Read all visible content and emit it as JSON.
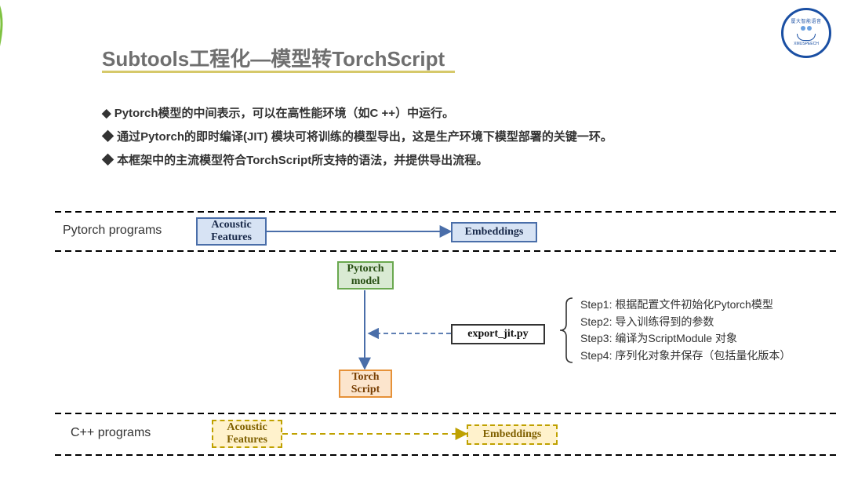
{
  "title": "Subtools工程化—模型转TorchScript",
  "bullets": {
    "b1": "Pytorch模型的中间表示，可以在高性能环境（如C ++）中运行。",
    "b2": "通过Pytorch的即时编译(JIT) 模块可将训练的模型导出，这是生产环境下模型部署的关键一环。",
    "b3": "本框架中的主流模型符合TorchScript所支持的语法，并提供导出流程。"
  },
  "rows": {
    "pytorch_label": "Pytorch programs",
    "cpp_label": "C++ programs"
  },
  "boxes": {
    "pt_acoustic": "Acoustic\nFeatures",
    "pt_embed": "Embeddings",
    "pt_model": "Pytorch\nmodel",
    "export": "export_jit.py",
    "torchscript": "Torch\nScript",
    "cpp_acoustic": "Acoustic\nFeatures",
    "cpp_embed": "Embeddings"
  },
  "steps": {
    "s1": "Step1: 根据配置文件初始化Pytorch模型",
    "s2": "Step2: 导入训练得到的参数",
    "s3": "Step3: 编译为ScriptModule 对象",
    "s4": "Step4: 序列化对象并保存（包括量化版本）"
  },
  "logo_text": "XMUSPEECH"
}
